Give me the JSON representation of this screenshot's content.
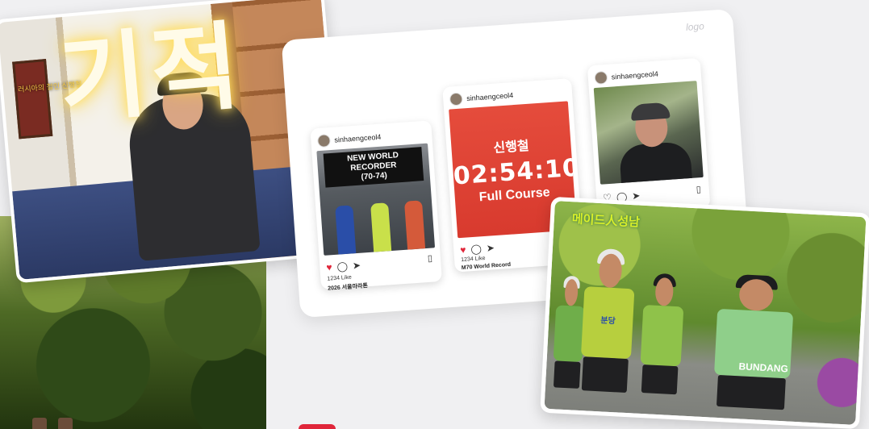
{
  "interview": {
    "big_text": "기적",
    "caption": "러시아의 철인 신행철"
  },
  "panel": {
    "logo": "logo"
  },
  "posts": [
    {
      "username": "sinhaengceol4",
      "banner": [
        "NEW WORLD",
        "RECORDER",
        "(70-74)"
      ],
      "likes": "1234 Like",
      "caption": "2026 서울마라톤"
    },
    {
      "username": "sinhaengceol4",
      "name": "신행철",
      "time": "02:54:10",
      "course": "Full Course",
      "likes": "1234 Like",
      "caption": "M70 World Record"
    },
    {
      "username": "sinhaengceol4"
    }
  ],
  "runners": {
    "logo": "메이드人성남",
    "shirt_text": "BUNDANG",
    "shirt_short": "분당"
  },
  "icons": {
    "heart": "heart-icon",
    "comment": "comment-icon",
    "share": "send-icon",
    "bookmark": "bookmark-icon"
  },
  "colors": {
    "heart": "#e0263a",
    "record_card": "#e54c3c",
    "banner_bg": "#111111"
  }
}
